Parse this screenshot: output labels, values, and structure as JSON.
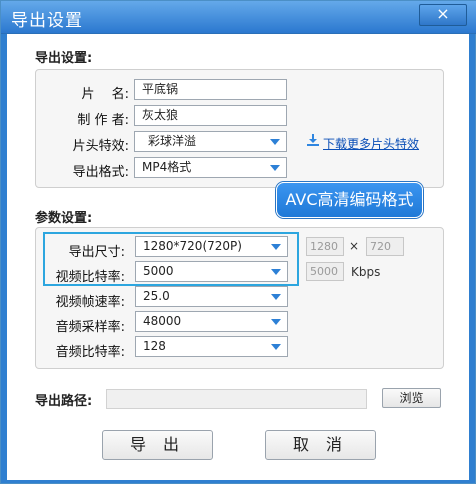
{
  "window": {
    "title": "导出设置",
    "close": "×"
  },
  "export_settings": {
    "heading": "导出设置:",
    "name_label": "片　 名:",
    "name_value": "平底锅",
    "author_label": "制 作 者:",
    "author_value": "灰太狼",
    "intro_label": "片头特效:",
    "intro_value": "彩球洋溢",
    "download_link": "下载更多片头特效",
    "format_label": "导出格式:",
    "format_value": "MP4格式",
    "tooltip": "AVC高清编码格式"
  },
  "params": {
    "heading": "参数设置:",
    "size_label": "导出尺寸:",
    "size_value": "1280*720(720P)",
    "width_value": "1280",
    "times": "×",
    "height_value": "720",
    "vbitrate_label": "视频比特率:",
    "vbitrate_value": "5000",
    "vbitrate_box": "5000",
    "kbps": "Kbps",
    "fps_label": "视频帧速率:",
    "fps_value": "25.0",
    "samplerate_label": "音频采样率:",
    "samplerate_value": "48000",
    "abitrate_label": "音频比特率:",
    "abitrate_value": "128"
  },
  "path": {
    "label": "导出路径:",
    "value": "",
    "browse": "浏览"
  },
  "actions": {
    "export": "导 出",
    "cancel": "取 消"
  },
  "colors": {
    "titlebar": "#2f7fd0",
    "accent": "#2da6df",
    "link": "#0b4fb7"
  },
  "icons": {
    "download": "download-icon",
    "dropdown": "chevron-down-icon"
  }
}
